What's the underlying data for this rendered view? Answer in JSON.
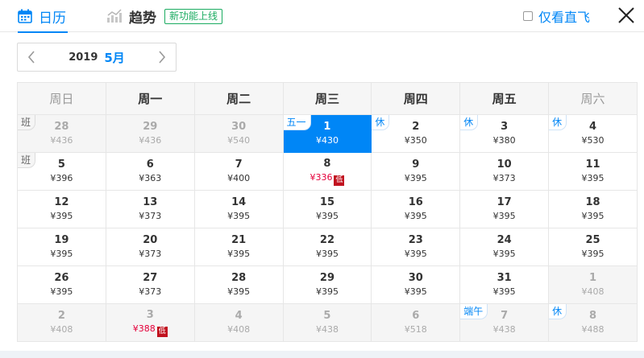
{
  "tabs": {
    "calendar": "日历",
    "trend": "趋势",
    "trend_badge": "新功能上线"
  },
  "direct_only": {
    "label": "仅看直飞",
    "checked": false
  },
  "month_selector": {
    "year": "2019",
    "month": "5月"
  },
  "weekdays": [
    "周日",
    "周一",
    "周二",
    "周三",
    "周四",
    "周五",
    "周六"
  ],
  "weeks": [
    [
      {
        "day": "28",
        "price": "¥436",
        "other": true,
        "tag": "班",
        "tag_type": "work"
      },
      {
        "day": "29",
        "price": "¥436",
        "other": true
      },
      {
        "day": "30",
        "price": "¥540",
        "other": true
      },
      {
        "day": "1",
        "price": "¥430",
        "selected": true,
        "tag": "五一",
        "tag_type": "holiday"
      },
      {
        "day": "2",
        "price": "¥350",
        "tag": "休",
        "tag_type": "holiday"
      },
      {
        "day": "3",
        "price": "¥380",
        "tag": "休",
        "tag_type": "holiday"
      },
      {
        "day": "4",
        "price": "¥530",
        "tag": "休",
        "tag_type": "holiday"
      }
    ],
    [
      {
        "day": "5",
        "price": "¥396",
        "tag": "班",
        "tag_type": "work"
      },
      {
        "day": "6",
        "price": "¥363"
      },
      {
        "day": "7",
        "price": "¥400"
      },
      {
        "day": "8",
        "price": "¥336",
        "low": true,
        "low_tag": "低"
      },
      {
        "day": "9",
        "price": "¥395"
      },
      {
        "day": "10",
        "price": "¥373"
      },
      {
        "day": "11",
        "price": "¥395"
      }
    ],
    [
      {
        "day": "12",
        "price": "¥395"
      },
      {
        "day": "13",
        "price": "¥373"
      },
      {
        "day": "14",
        "price": "¥395"
      },
      {
        "day": "15",
        "price": "¥395"
      },
      {
        "day": "16",
        "price": "¥395"
      },
      {
        "day": "17",
        "price": "¥395"
      },
      {
        "day": "18",
        "price": "¥395"
      }
    ],
    [
      {
        "day": "19",
        "price": "¥395"
      },
      {
        "day": "20",
        "price": "¥373"
      },
      {
        "day": "21",
        "price": "¥395"
      },
      {
        "day": "22",
        "price": "¥395"
      },
      {
        "day": "23",
        "price": "¥395"
      },
      {
        "day": "24",
        "price": "¥395"
      },
      {
        "day": "25",
        "price": "¥395"
      }
    ],
    [
      {
        "day": "26",
        "price": "¥395"
      },
      {
        "day": "27",
        "price": "¥373"
      },
      {
        "day": "28",
        "price": "¥395"
      },
      {
        "day": "29",
        "price": "¥395"
      },
      {
        "day": "30",
        "price": "¥395"
      },
      {
        "day": "31",
        "price": "¥395"
      },
      {
        "day": "1",
        "price": "¥408",
        "other": true
      }
    ],
    [
      {
        "day": "2",
        "price": "¥408",
        "other": true
      },
      {
        "day": "3",
        "price": "¥388",
        "other": true,
        "low": true,
        "low_tag": "低"
      },
      {
        "day": "4",
        "price": "¥408",
        "other": true
      },
      {
        "day": "5",
        "price": "¥438",
        "other": true
      },
      {
        "day": "6",
        "price": "¥518",
        "other": true
      },
      {
        "day": "7",
        "price": "¥438",
        "other": true,
        "tag": "端午",
        "tag_type": "holiday"
      },
      {
        "day": "8",
        "price": "¥488",
        "other": true,
        "tag": "休",
        "tag_type": "holiday"
      }
    ]
  ],
  "colors": {
    "accent": "#0086f6",
    "low_price": "#e4003a",
    "new_badge": "#1aab60"
  },
  "icons": {
    "calendar": "calendar-icon",
    "trend": "trend-chart-icon",
    "close": "close-icon",
    "prev": "chevron-left-icon",
    "next": "chevron-right-icon"
  }
}
